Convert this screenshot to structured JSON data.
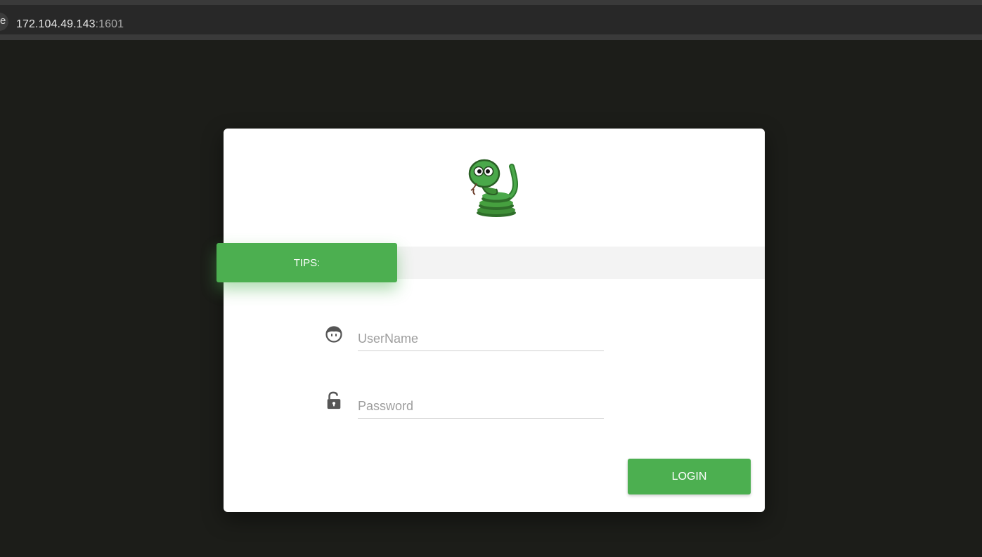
{
  "browser": {
    "url_host": "172.104.49.143",
    "url_port": ":1601",
    "edge_glyph": "e"
  },
  "login": {
    "logo_icon": "snake-mascot-icon",
    "tips_label": "TIPS:",
    "username_placeholder": "UserName",
    "username_icon": "user-face-icon",
    "password_placeholder": "Password",
    "password_icon": "unlock-icon",
    "login_label": "LOGIN"
  },
  "colors": {
    "accent": "#4caf50",
    "page_background": "#1c1d19",
    "card_background": "#ffffff",
    "tips_band": "#f3f3f3"
  }
}
